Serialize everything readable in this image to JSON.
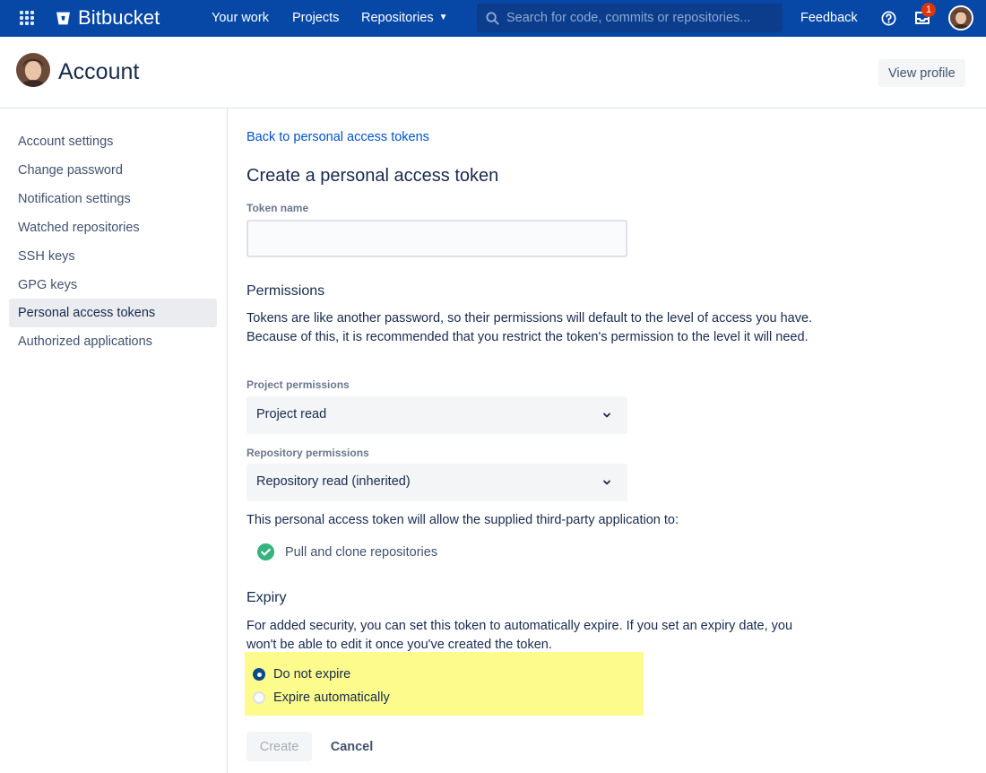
{
  "topnav": {
    "brand": "Bitbucket",
    "links": [
      "Your work",
      "Projects",
      "Repositories"
    ],
    "search_placeholder": "Search for code, commits or repositories...",
    "feedback": "Feedback",
    "notification_count": "1"
  },
  "header": {
    "title": "Account",
    "view_profile": "View profile"
  },
  "sidebar": {
    "items": [
      {
        "label": "Account settings"
      },
      {
        "label": "Change password"
      },
      {
        "label": "Notification settings"
      },
      {
        "label": "Watched repositories"
      },
      {
        "label": "SSH keys"
      },
      {
        "label": "GPG keys"
      },
      {
        "label": "Personal access tokens",
        "active": true
      },
      {
        "label": "Authorized applications"
      }
    ]
  },
  "main": {
    "back_link": "Back to personal access tokens",
    "heading": "Create a personal access token",
    "token_name_label": "Token name",
    "token_name_value": "",
    "permissions": {
      "heading": "Permissions",
      "description": "Tokens are like another password, so their permissions will default to the level of access you have. Because of this, it is recommended that you restrict the token's permission to the level it will need.",
      "project_label": "Project permissions",
      "project_value": "Project read",
      "repository_label": "Repository permissions",
      "repository_value": "Repository read (inherited)",
      "allow_text": "This personal access token will allow the supplied third-party application to:",
      "granted": [
        "Pull and clone repositories"
      ]
    },
    "expiry": {
      "heading": "Expiry",
      "description": "For added security, you can set this token to automatically expire. If you set an expiry date, you won't be able to edit it once you've created the token.",
      "options": [
        {
          "label": "Do not expire",
          "selected": true
        },
        {
          "label": "Expire automatically",
          "selected": false
        }
      ]
    },
    "buttons": {
      "create": "Create",
      "cancel": "Cancel"
    }
  },
  "colors": {
    "nav_bg": "#0747a6",
    "link": "#0052cc",
    "highlight": "#fdfb8c",
    "success": "#36b37e"
  }
}
